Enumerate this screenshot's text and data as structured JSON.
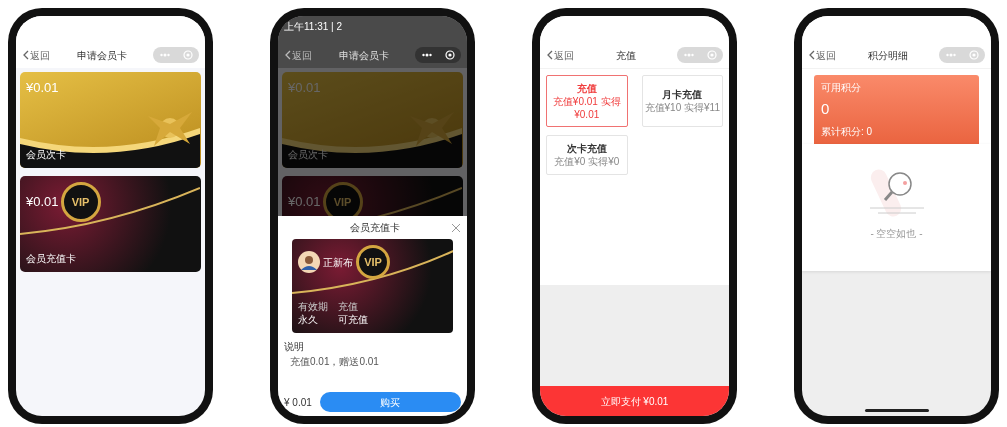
{
  "phones": [
    {
      "kind": "card_list",
      "nav": {
        "back": "返回",
        "title": "申请会员卡"
      },
      "dimmed": false,
      "cards": [
        {
          "kind": "gold",
          "price": "¥0.01",
          "name": "会员次卡"
        },
        {
          "kind": "vip",
          "price": "¥0.01",
          "emblem": "VIP",
          "name": "会员充值卡"
        }
      ]
    },
    {
      "kind": "card_list",
      "status_time": "上午11:31 | 2",
      "nav": {
        "back": "返回",
        "title": "申请会员卡"
      },
      "dimmed": true,
      "cards": [
        {
          "kind": "gold",
          "price": "¥0.01",
          "name": "会员次卡"
        },
        {
          "kind": "vip",
          "price": "¥0.01",
          "emblem": "VIP"
        }
      ],
      "sheet": {
        "title": "会员充值卡",
        "card": {
          "holder": "正新布",
          "emblem": "VIP",
          "fields": [
            {
              "label": "有效期",
              "value": "永久"
            },
            {
              "label": "充值",
              "value": "可充值"
            }
          ]
        },
        "section_title": "说明",
        "description": "充值0.01，赠送0.01",
        "price": "¥ 0.01",
        "buy": "购买"
      }
    },
    {
      "kind": "recharge",
      "nav": {
        "back": "返回",
        "title": "充值"
      },
      "options": [
        {
          "title": "充值",
          "detail": "充值¥0.01 实得¥0.01",
          "selected": true
        },
        {
          "title": "月卡充值",
          "detail": "充值¥10 实得¥11",
          "selected": false
        },
        {
          "title": "次卡充值",
          "detail": "充值¥0 实得¥0",
          "selected": false
        }
      ],
      "pay": "立即支付 ¥0.01"
    },
    {
      "kind": "points",
      "nav": {
        "back": "返回",
        "title": "积分明细"
      },
      "points": {
        "label": "可用积分",
        "value": "0",
        "total": "累计积分: 0"
      },
      "empty": "- 空空如也 -"
    }
  ]
}
